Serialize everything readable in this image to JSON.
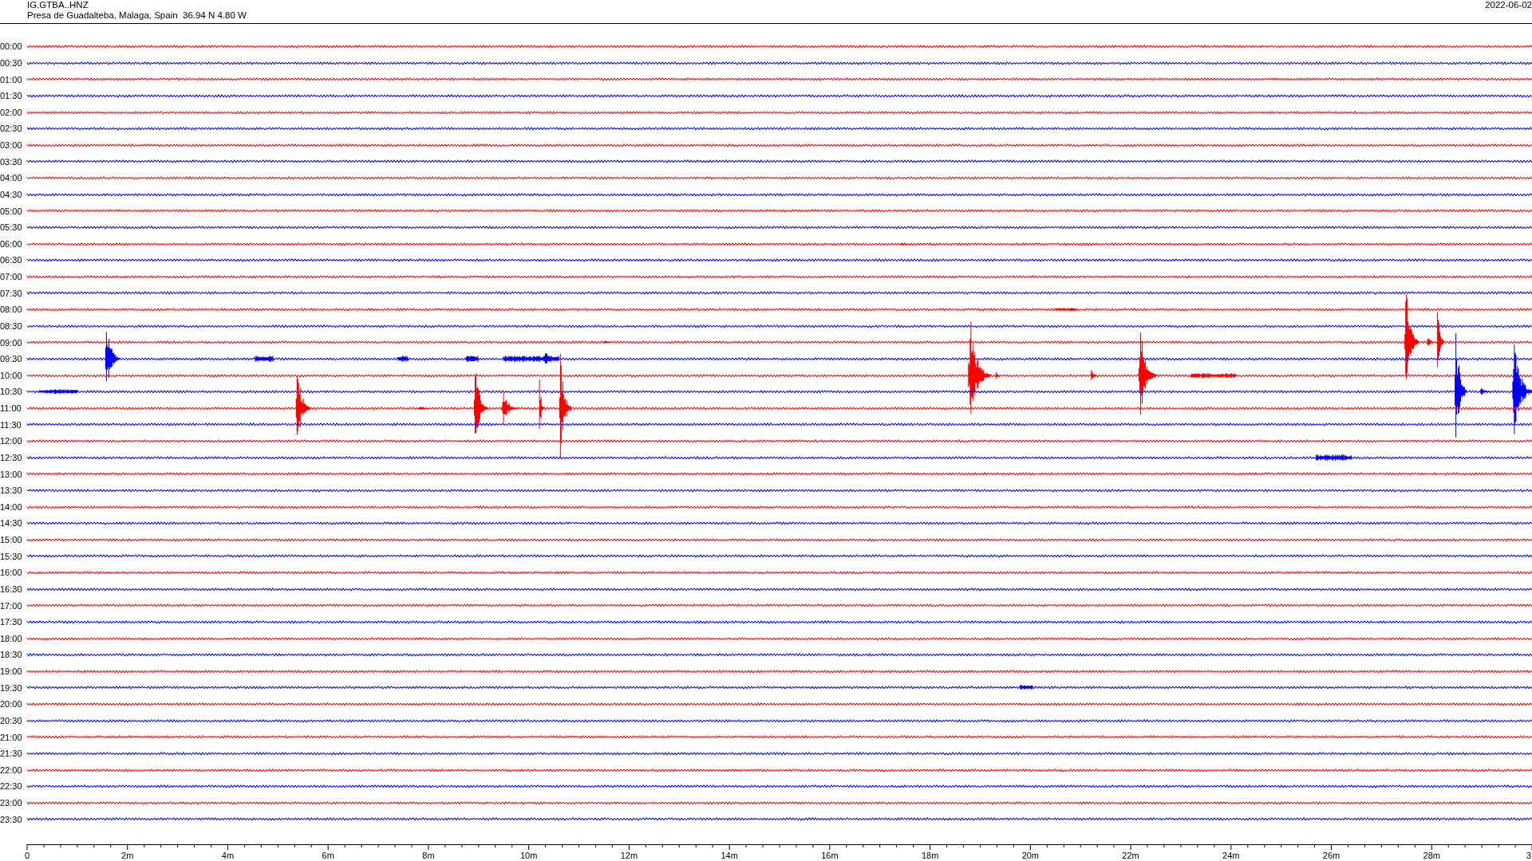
{
  "header": {
    "station": "IG.GTBA..HNZ",
    "location": "Presa de Guadalteba, Malaga, Spain  36.94 N 4.80 W",
    "date": "2022-06-02"
  },
  "traces": [
    {
      "label": "00:00",
      "color": "#ff0000"
    },
    {
      "label": "00:30",
      "color": "#0000ff"
    },
    {
      "label": "01:00",
      "color": "#ff0000"
    },
    {
      "label": "01:30",
      "color": "#0000ff"
    },
    {
      "label": "02:00",
      "color": "#ff0000"
    },
    {
      "label": "02:30",
      "color": "#0000ff"
    },
    {
      "label": "03:00",
      "color": "#ff0000"
    },
    {
      "label": "03:30",
      "color": "#0000ff"
    },
    {
      "label": "04:00",
      "color": "#ff0000"
    },
    {
      "label": "04:30",
      "color": "#0000ff"
    },
    {
      "label": "05:00",
      "color": "#ff0000"
    },
    {
      "label": "05:30",
      "color": "#0000ff"
    },
    {
      "label": "06:00",
      "color": "#ff0000"
    },
    {
      "label": "06:30",
      "color": "#0000ff"
    },
    {
      "label": "07:00",
      "color": "#ff0000"
    },
    {
      "label": "07:30",
      "color": "#0000ff"
    },
    {
      "label": "08:00",
      "color": "#ff0000"
    },
    {
      "label": "08:30",
      "color": "#0000ff"
    },
    {
      "label": "09:00",
      "color": "#ff0000"
    },
    {
      "label": "09:30",
      "color": "#0000ff"
    },
    {
      "label": "10:00",
      "color": "#ff0000"
    },
    {
      "label": "10:30",
      "color": "#0000ff"
    },
    {
      "label": "11:00",
      "color": "#ff0000"
    },
    {
      "label": "11:30",
      "color": "#0000ff"
    },
    {
      "label": "12:00",
      "color": "#ff0000"
    },
    {
      "label": "12:30",
      "color": "#0000ff"
    },
    {
      "label": "13:00",
      "color": "#ff0000"
    },
    {
      "label": "13:30",
      "color": "#0000ff"
    },
    {
      "label": "14:00",
      "color": "#ff0000"
    },
    {
      "label": "14:30",
      "color": "#0000ff"
    },
    {
      "label": "15:00",
      "color": "#ff0000"
    },
    {
      "label": "15:30",
      "color": "#0000ff"
    },
    {
      "label": "16:00",
      "color": "#ff0000"
    },
    {
      "label": "16:30",
      "color": "#0000ff"
    },
    {
      "label": "17:00",
      "color": "#ff0000"
    },
    {
      "label": "17:30",
      "color": "#0000ff"
    },
    {
      "label": "18:00",
      "color": "#ff0000"
    },
    {
      "label": "18:30",
      "color": "#0000ff"
    },
    {
      "label": "19:00",
      "color": "#ff0000"
    },
    {
      "label": "19:30",
      "color": "#0000ff"
    },
    {
      "label": "20:00",
      "color": "#ff0000"
    },
    {
      "label": "20:30",
      "color": "#0000ff"
    },
    {
      "label": "21:00",
      "color": "#ff0000"
    },
    {
      "label": "21:30",
      "color": "#0000ff"
    },
    {
      "label": "22:00",
      "color": "#ff0000"
    },
    {
      "label": "22:30",
      "color": "#0000ff"
    },
    {
      "label": "23:00",
      "color": "#ff0000"
    },
    {
      "label": "23:30",
      "color": "#0000ff"
    }
  ],
  "time_axis": {
    "ticks": [
      "0",
      "2m",
      "4m",
      "6m",
      "8m",
      "10m",
      "12m",
      "14m",
      "16m",
      "18m",
      "20m",
      "22m",
      "24m",
      "26m",
      "28m",
      "3"
    ]
  }
}
